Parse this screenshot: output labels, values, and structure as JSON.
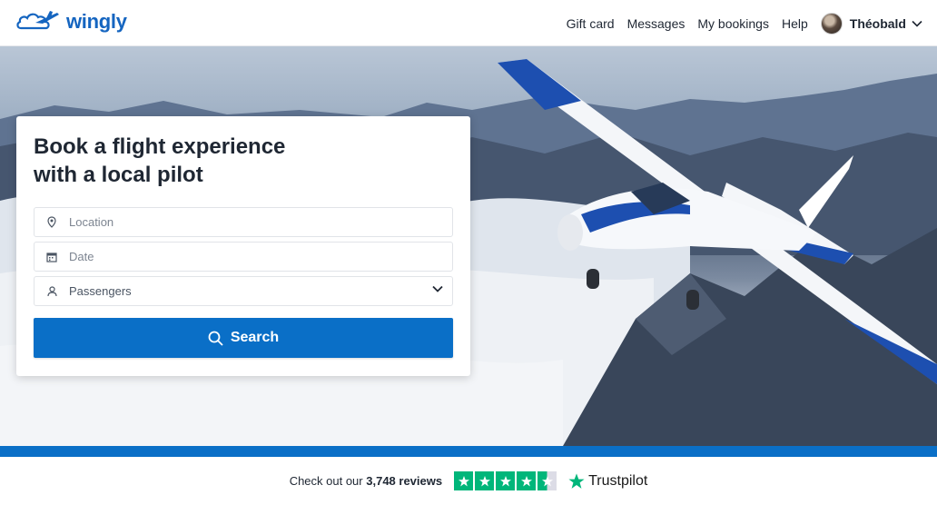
{
  "header": {
    "logo_text": "wingly",
    "nav": [
      "Gift card",
      "Messages",
      "My bookings",
      "Help"
    ],
    "user_name": "Théobald"
  },
  "search_card": {
    "title_line1": "Book a flight experience",
    "title_line2": "with a local pilot",
    "location_placeholder": "Location",
    "date_placeholder": "Date",
    "passengers_label": "Passengers",
    "search_label": "Search"
  },
  "trustpilot": {
    "prefix": "Check out our",
    "count": "3,748 reviews",
    "brand": "Trustpilot",
    "rating_stars": 4.5
  },
  "colors": {
    "brand_blue": "#0a6fc7",
    "trustpilot_green": "#00b67a"
  }
}
